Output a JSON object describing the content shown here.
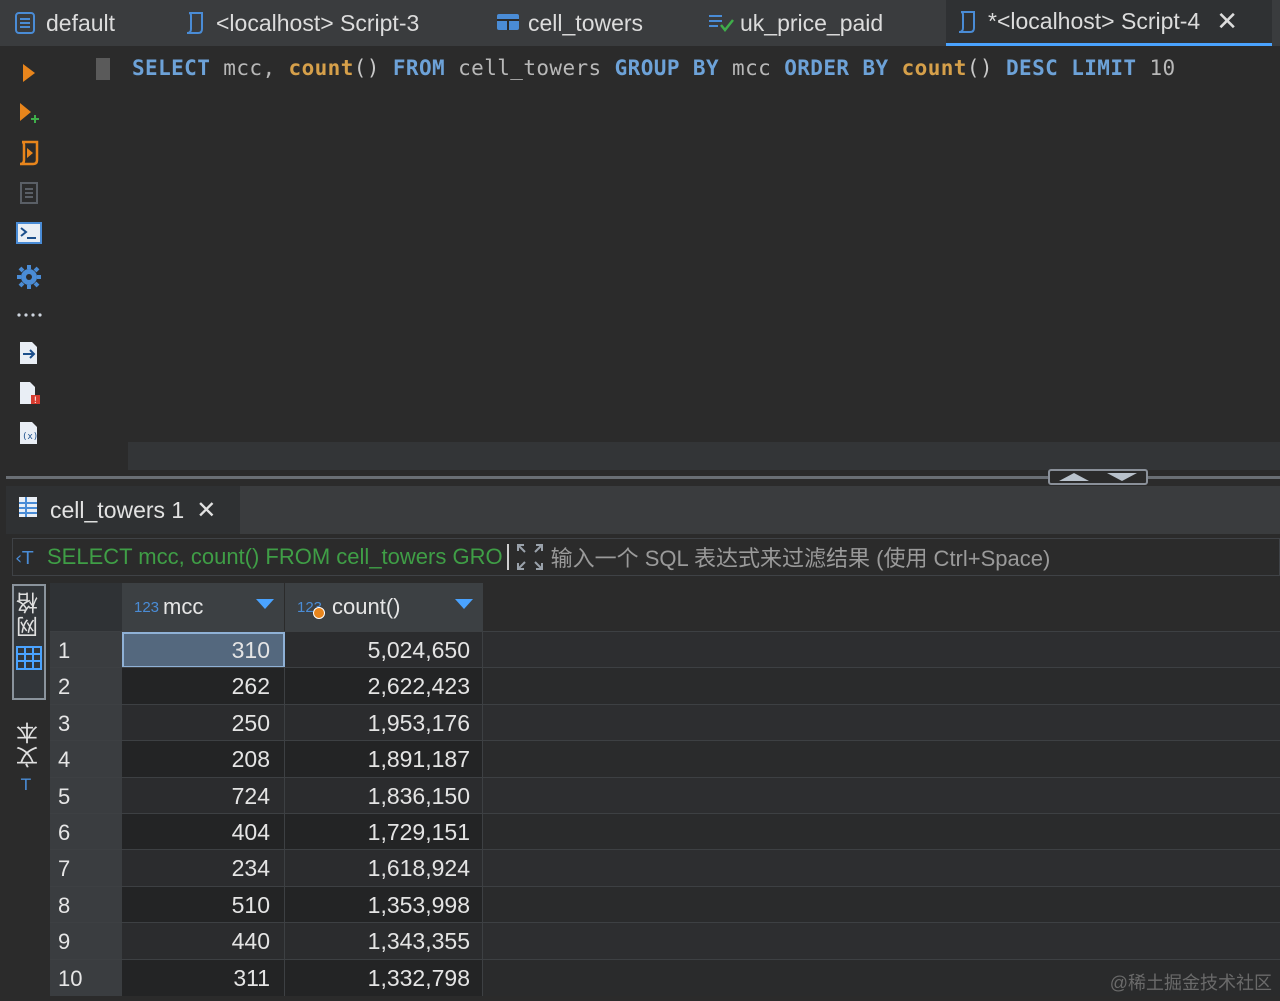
{
  "tabs": [
    {
      "label": "default",
      "icon": "database-icon",
      "active": false
    },
    {
      "label": "<localhost> Script-3",
      "icon": "script-icon",
      "active": false
    },
    {
      "label": "cell_towers",
      "icon": "table-icon",
      "active": false
    },
    {
      "label": "uk_price_paid",
      "icon": "query-icon",
      "active": false
    },
    {
      "label": "*<localhost> Script-4",
      "icon": "script-icon",
      "active": true,
      "close": "✕"
    }
  ],
  "editor": {
    "sql_tokens": [
      {
        "t": "SELECT",
        "c": "kw"
      },
      {
        "t": " mcc, ",
        "c": "id"
      },
      {
        "t": "count",
        "c": "fn"
      },
      {
        "t": "() ",
        "c": "pn"
      },
      {
        "t": "FROM",
        "c": "kw"
      },
      {
        "t": " cell_towers ",
        "c": "id"
      },
      {
        "t": "GROUP BY",
        "c": "kw"
      },
      {
        "t": " mcc ",
        "c": "id"
      },
      {
        "t": "ORDER BY",
        "c": "kw"
      },
      {
        "t": " ",
        "c": "id"
      },
      {
        "t": "count",
        "c": "fn"
      },
      {
        "t": "() ",
        "c": "pn"
      },
      {
        "t": "DESC",
        "c": "kw"
      },
      {
        "t": " ",
        "c": "id"
      },
      {
        "t": "LIMIT",
        "c": "kw"
      },
      {
        "t": " 10",
        "c": "id"
      }
    ]
  },
  "toolbar": {
    "icons": [
      "execute-icon",
      "execute-new-tab-icon",
      "execute-script-icon",
      "execute-script-disabled-icon",
      "terminal-icon",
      "settings-icon",
      "more-icon",
      "export-icon",
      "delete-icon",
      "variables-icon"
    ]
  },
  "results": {
    "tab_label": "cell_towers 1",
    "tab_close": "✕",
    "filter_query": "SELECT mcc, count() FROM cell_towers GRO",
    "filter_placeholder": "输入一个 SQL 表达式来过滤结果 (使用 Ctrl+Space)",
    "side_tab_grid": "网格",
    "side_tab_text": "文本",
    "columns": [
      {
        "type": "123",
        "name": "mcc"
      },
      {
        "type": "123",
        "name": "count()"
      }
    ],
    "rows": [
      {
        "n": "1",
        "mcc": "310",
        "count": "5,024,650"
      },
      {
        "n": "2",
        "mcc": "262",
        "count": "2,622,423"
      },
      {
        "n": "3",
        "mcc": "250",
        "count": "1,953,176"
      },
      {
        "n": "4",
        "mcc": "208",
        "count": "1,891,187"
      },
      {
        "n": "5",
        "mcc": "724",
        "count": "1,836,150"
      },
      {
        "n": "6",
        "mcc": "404",
        "count": "1,729,151"
      },
      {
        "n": "7",
        "mcc": "234",
        "count": "1,618,924"
      },
      {
        "n": "8",
        "mcc": "510",
        "count": "1,353,998"
      },
      {
        "n": "9",
        "mcc": "440",
        "count": "1,343,355"
      },
      {
        "n": "10",
        "mcc": "311",
        "count": "1,332,798"
      }
    ]
  },
  "watermark": "@稀土掘金技术社区",
  "colors": {
    "keyword": "#6da2d8",
    "function": "#d6a04a",
    "accent": "#4aa3ff",
    "filter_query": "#3f9e46"
  }
}
